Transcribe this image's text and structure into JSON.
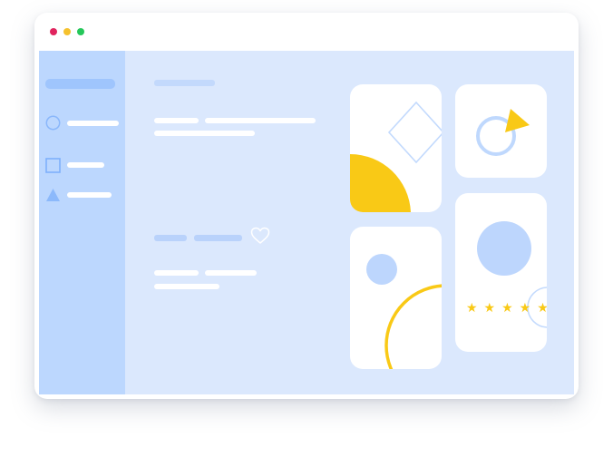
{
  "window": {
    "controls": [
      {
        "name": "close",
        "color": "#e0245e"
      },
      {
        "name": "minimize",
        "color": "#f5c12e"
      },
      {
        "name": "maximize",
        "color": "#25c75a"
      }
    ]
  },
  "sidebar": {
    "items": [
      {
        "icon": "circle-icon"
      },
      {
        "icon": "square-icon"
      },
      {
        "icon": "triangle-icon"
      }
    ]
  },
  "main": {
    "favorite_icon": "heart-icon"
  },
  "cards": {
    "rating": {
      "stars": "★★★★★",
      "value": 5,
      "max": 5
    }
  },
  "colors": {
    "accent_blue": "#bcd7fe",
    "background": "#dbe8fd",
    "line_blue": "#b8d2fb",
    "accent_yellow": "#f9c916",
    "card": "#ffffff"
  }
}
